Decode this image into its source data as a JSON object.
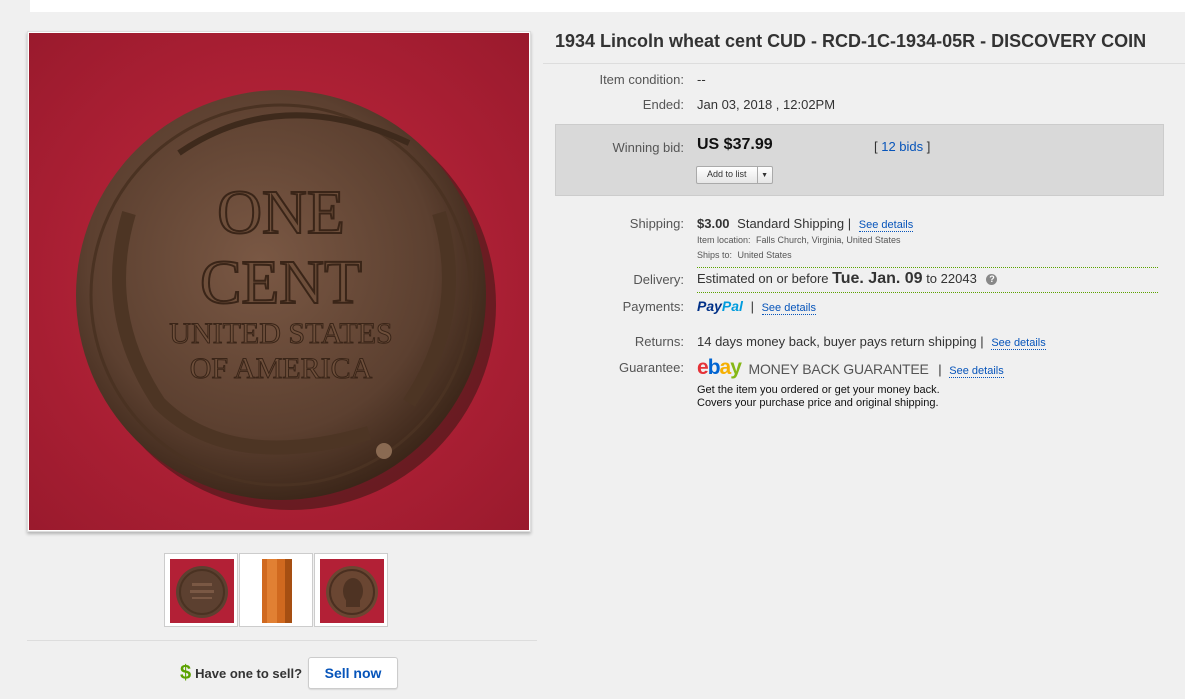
{
  "title": "1934 Lincoln wheat cent CUD - RCD-1C-1934-05R - DISCOVERY COIN",
  "gallery": {
    "main_image_icon": "coin-reverse-photo",
    "thumbnails": [
      {
        "icon": "coin-reverse-thumbnail"
      },
      {
        "icon": "coin-edge-thumbnail"
      },
      {
        "icon": "coin-obverse-thumbnail"
      }
    ],
    "sell_question": "Have one to sell?",
    "sell_dollar": "$",
    "sell_button": "Sell now"
  },
  "details": {
    "condition_label": "Item condition:",
    "condition_value": "--",
    "ended_label": "Ended:",
    "ended_value": "Jan 03, 2018 , 12:02PM",
    "winning_label": "Winning bid:",
    "winning_value": "US $37.99",
    "bids_open": "[ ",
    "bids_link": "12 bids",
    "bids_close": " ]",
    "add_to_list": "Add to list",
    "shipping_label": "Shipping:",
    "shipping_cost": "$3.00",
    "shipping_service": "Standard Shipping",
    "shipping_sep": "|",
    "shipping_link": "See details",
    "item_location_label": "Item location:",
    "item_location": "Falls Church, Virginia, United States",
    "ships_to_label": "Ships to:",
    "ships_to": "United States",
    "delivery_label": "Delivery:",
    "delivery_prefix": "Estimated on or before",
    "delivery_date": "Tue. Jan. 09",
    "delivery_to": "to",
    "delivery_zip": "22043",
    "payments_label": "Payments:",
    "paypal_1": "Pay",
    "paypal_2": "Pal",
    "payments_sep": "|",
    "payments_link": "See details",
    "returns_label": "Returns:",
    "returns_value": "14 days money back, buyer pays return shipping",
    "returns_sep": "|",
    "returns_link": "See details",
    "guarantee_label": "Guarantee:",
    "ebay_e": "e",
    "ebay_b": "b",
    "ebay_a": "a",
    "ebay_y": "y",
    "mbg_text": "MONEY BACK GUARANTEE",
    "guarantee_sep": "|",
    "guarantee_link": "See details",
    "guarantee_line1": "Get the item you ordered or get your money back.",
    "guarantee_line2": "Covers your purchase price and original shipping."
  },
  "colors": {
    "link": "#0654ba",
    "bid_box": "#d9d9d9",
    "delivery_rule": "#5ba200",
    "coin_background": "#b32036"
  }
}
